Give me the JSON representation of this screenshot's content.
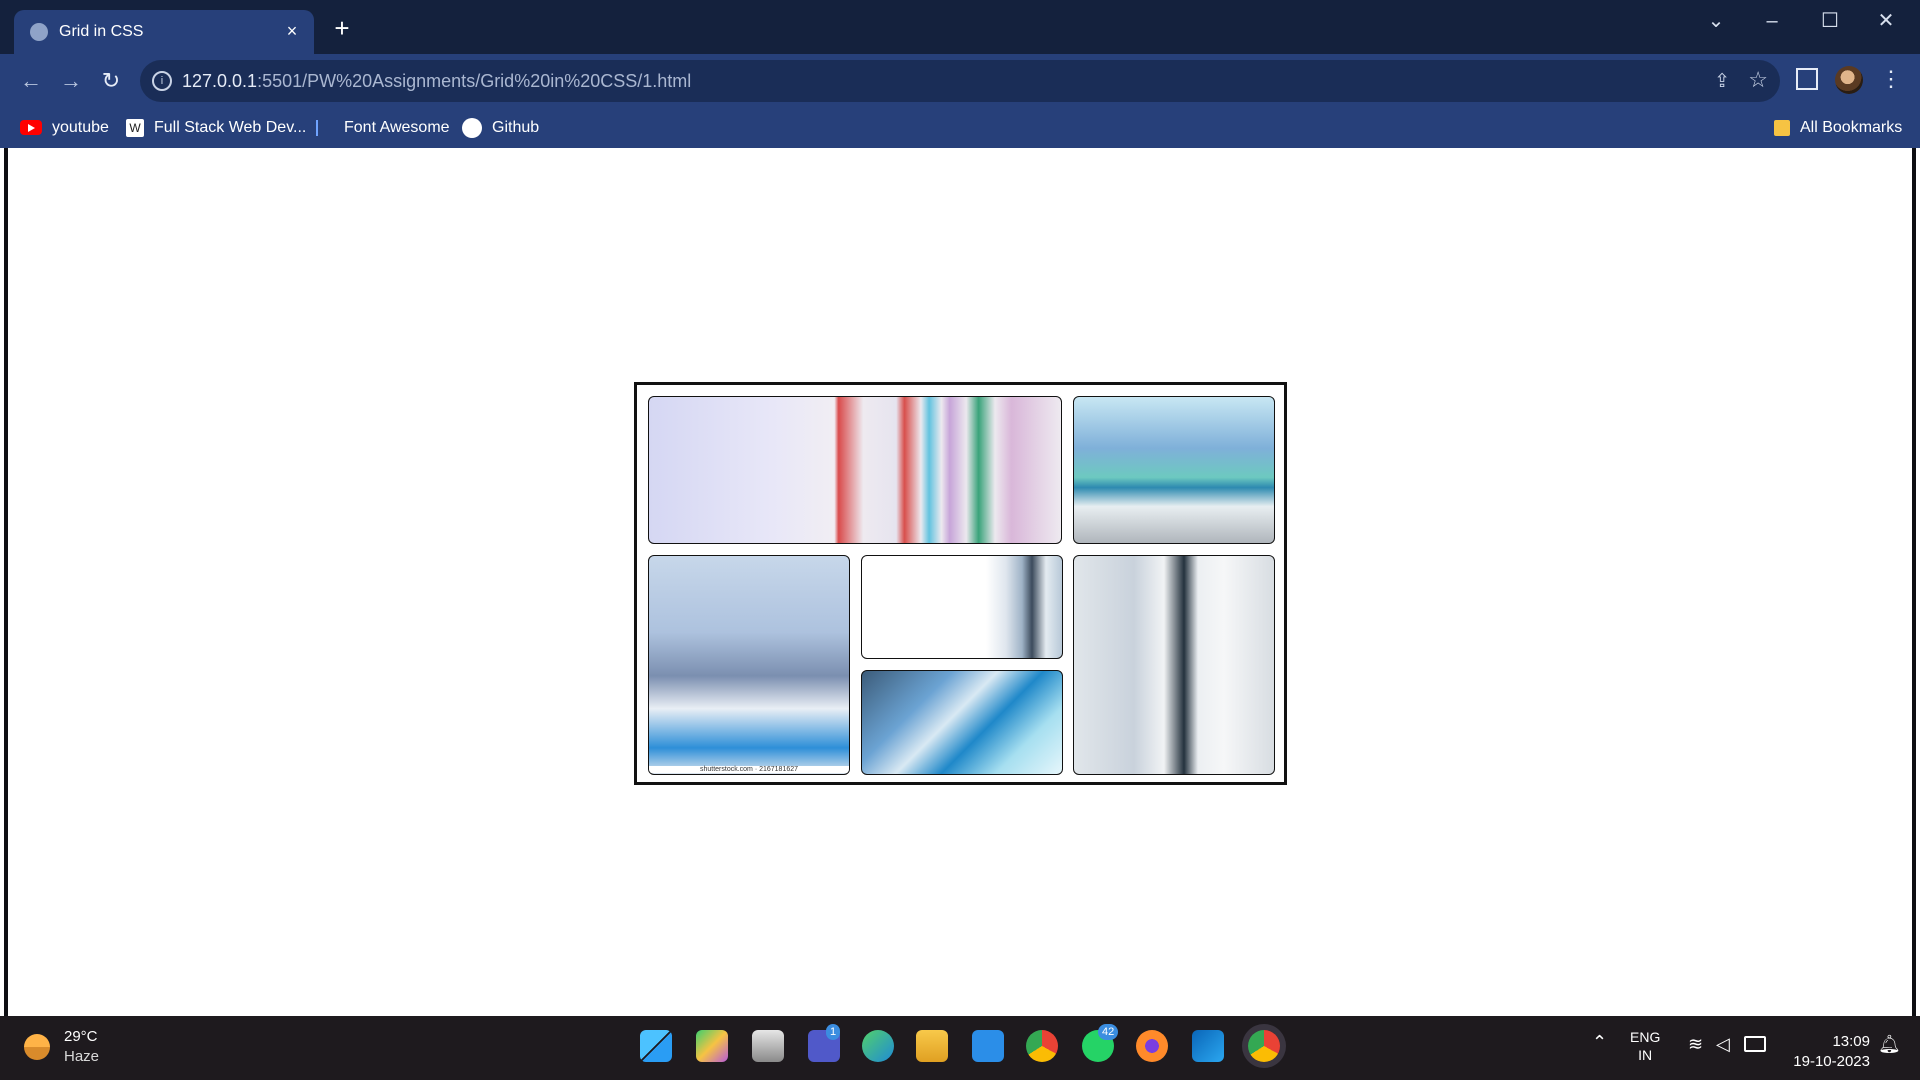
{
  "browser": {
    "tab": {
      "title": "Grid in CSS",
      "close": "×"
    },
    "new_tab": "+",
    "window_controls": {
      "tab_search": "⌄",
      "minimize": "–",
      "maximize": "☐",
      "close": "✕"
    },
    "nav": {
      "back": "←",
      "forward": "→",
      "reload": "↻"
    },
    "address": {
      "host": "127.0.0.1",
      "path": ":5501/PW%20Assignments/Grid%20in%20CSS/1.html"
    },
    "bookmarks": [
      {
        "label": "youtube",
        "icon": "youtube-icon"
      },
      {
        "label": "Full Stack Web Dev...",
        "icon": "wordpress-icon"
      },
      {
        "label": "Font Awesome",
        "icon": "flag-icon"
      },
      {
        "label": "Github",
        "icon": "github-icon"
      }
    ],
    "all_bookmarks": "All Bookmarks"
  },
  "page": {
    "grid_images": [
      {
        "name": "blood-test-tubes-wide",
        "caption": ""
      },
      {
        "name": "blood-tube-hand",
        "caption": ""
      },
      {
        "name": "scientist-microscope",
        "caption": "shutterstock.com · 2167181627"
      },
      {
        "name": "lab-microscope-small",
        "caption": ""
      },
      {
        "name": "microscope-closeup",
        "caption": ""
      },
      {
        "name": "lab-team",
        "caption": ""
      }
    ]
  },
  "taskbar": {
    "weather": {
      "temp": "29°C",
      "condition": "Haze"
    },
    "teams_badge": "1",
    "whatsapp_badge": "42",
    "lang": {
      "line1": "ENG",
      "line2": "IN"
    },
    "clock": {
      "time": "13:09",
      "date": "19-10-2023"
    }
  }
}
